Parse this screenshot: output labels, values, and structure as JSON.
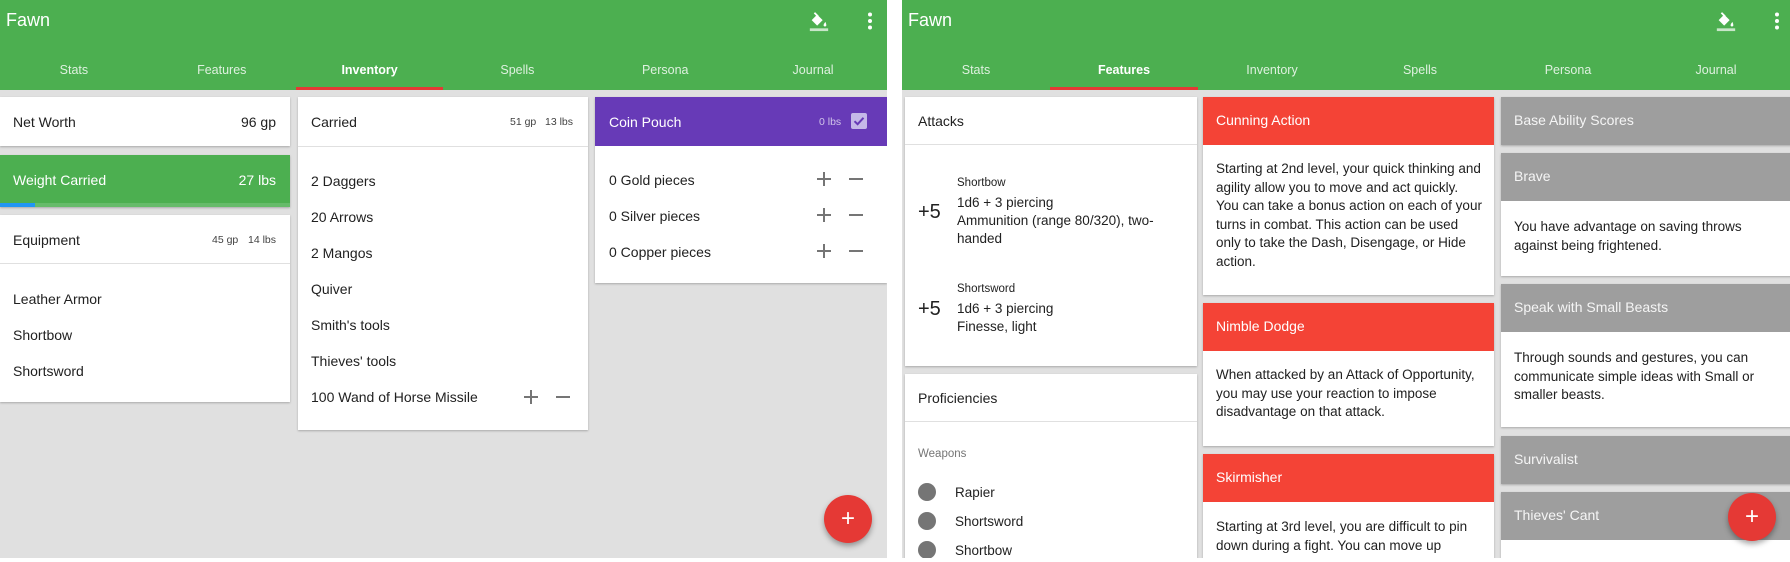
{
  "app": {
    "title": "Fawn"
  },
  "tabs": [
    "Stats",
    "Features",
    "Inventory",
    "Spells",
    "Persona",
    "Journal"
  ],
  "colors": {
    "primary": "#4caf50",
    "accent": "#e53935",
    "coin_pouch": "#673ab7",
    "feature_header": "#f44336",
    "ability_header": "#9e9e9e"
  },
  "icons": {
    "theme": "paint-bucket-icon",
    "menu": "more-vert-icon",
    "fab": "add-icon"
  },
  "inventory": {
    "net_worth": {
      "label": "Net Worth",
      "value": "96 gp"
    },
    "weight": {
      "label": "Weight Carried",
      "value": "27 lbs",
      "capacity_fraction": 0.12
    },
    "equipment": {
      "title": "Equipment",
      "gp": "45 gp",
      "lbs": "14 lbs",
      "items": [
        "Leather Armor",
        "Shortbow",
        "Shortsword"
      ]
    },
    "carried": {
      "title": "Carried",
      "gp": "51 gp",
      "lbs": "13 lbs",
      "items": [
        "2 Daggers",
        "20 Arrows",
        "2 Mangos",
        "Quiver",
        "Smith's tools",
        "Thieves' tools",
        "100 Wand of Horse Missile"
      ]
    },
    "coin_pouch": {
      "title": "Coin Pouch",
      "lbs": "0 lbs",
      "checked": true,
      "coins": [
        "0 Gold pieces",
        "0 Silver pieces",
        "0 Copper pieces"
      ]
    },
    "fab_label": "+"
  },
  "features": {
    "attacks": {
      "title": "Attacks",
      "items": [
        {
          "bonus": "+5",
          "name": "Shortbow",
          "damage": "1d6 + 3 piercing",
          "properties": "Ammunition (range 80/320), two-handed"
        },
        {
          "bonus": "+5",
          "name": "Shortsword",
          "damage": "1d6 + 3 piercing",
          "properties": "Finesse, light"
        }
      ]
    },
    "proficiencies": {
      "title": "Proficiencies",
      "section": "Weapons",
      "items": [
        "Rapier",
        "Shortsword",
        "Shortbow"
      ]
    },
    "class_features": [
      {
        "title": "Cunning Action",
        "text": "Starting at 2nd level, your quick thinking and agility allow you to move and act quickly. You can take a bonus action on each of your turns in combat. This action can be used only to take the Dash, Disengage, or Hide action."
      },
      {
        "title": "Nimble Dodge",
        "text": "When attacked by an Attack of Opportunity, you may use your reaction to impose disadvantage on that attack."
      },
      {
        "title": "Skirmisher",
        "text": "Starting at 3rd level, you are difficult to pin down during a fight. You can move up"
      }
    ],
    "racial": {
      "base": "Base Ability Scores",
      "brave": {
        "title": "Brave",
        "text": "You have advantage on saving throws against being frightened."
      },
      "beasts": {
        "title": "Speak with Small Beasts",
        "text": "Through sounds and gestures, you can communicate simple ideas with Small or smaller beasts."
      },
      "survivalist": "Survivalist",
      "cant": "Thieves' Cant"
    },
    "fab_label": "+"
  }
}
